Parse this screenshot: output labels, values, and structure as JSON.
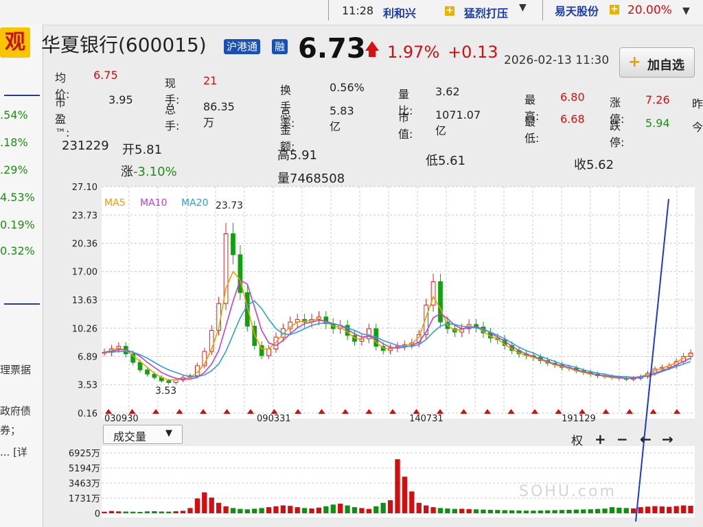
{
  "topbar": {
    "time": "11:28",
    "stock1": "利和兴",
    "message": "猛烈打压",
    "stock2": "易天股份",
    "stock2_pct": "20.00%"
  },
  "left_panel": {
    "logo_char": "观",
    "pcts": [
      ".54%",
      ".18%",
      ".29%",
      "4.53%",
      "0.19%",
      "0.32%"
    ],
    "texts": [
      "理票据",
      "政府债",
      "券；",
      "... [详"
    ]
  },
  "header": {
    "name": "华夏银行(600015)",
    "badge1": "沪港通",
    "badge2": "融",
    "price": "6.73",
    "pct": "1.97%",
    "change": "+0.13",
    "datetime": "2026-02-13 11:30",
    "add_button": "加自选"
  },
  "stats": {
    "avg_label": "均价:",
    "avg": "6.75",
    "pe_label": "市盈™:",
    "pe": "3.95",
    "cur_hand_label": "现手:",
    "cur_hand": "21",
    "total_hand_label": "总手:",
    "total_hand": "86.35万",
    "turnover_label": "换手率:",
    "turnover": "0.56%",
    "amount_label": "总金额:",
    "amount": "5.83亿",
    "vol_ratio_label": "量比:",
    "vol_ratio": "3.62",
    "mcap_label": "市值:",
    "mcap": "1071.07亿",
    "high_label": "最高:",
    "high": "6.80",
    "low_label": "最低:",
    "low": "6.68",
    "limit_up_label": "涨停:",
    "limit_up": "7.26",
    "limit_down_label": "跌停:",
    "limit_down": "5.94",
    "cut1": "昨",
    "cut2": "今"
  },
  "candle_info": {
    "date": "231229",
    "open": "开5.81",
    "high": "高5.91",
    "low": "低5.61",
    "close": "收5.62",
    "change": "涨-3.10%",
    "volume": "量7468508"
  },
  "chart_data": {
    "type": "line",
    "y_ticks": [
      "27.10",
      "23.73",
      "20.36",
      "17.00",
      "13.63",
      "10.26",
      "6.89",
      "3.53",
      "0.16"
    ],
    "ylim": [
      0.16,
      27.1
    ],
    "x_ticks": [
      "030930",
      "090331",
      "140731",
      "191129"
    ],
    "legend": [
      "MA5",
      "MA10",
      "MA20"
    ],
    "max_label": "23.73",
    "min_label": "3.53",
    "x": [
      0,
      3,
      6,
      9,
      12,
      15,
      18,
      21,
      24,
      27,
      30,
      33,
      36,
      39,
      42,
      45,
      48,
      51,
      54,
      57,
      60,
      63,
      66,
      69,
      72,
      75,
      78,
      81,
      84,
      87,
      90,
      93,
      96,
      99,
      102,
      105,
      108,
      111,
      114,
      117,
      120,
      123,
      126,
      129,
      132,
      135,
      138,
      141,
      144,
      147,
      150,
      153,
      156,
      159,
      162,
      165,
      168,
      171,
      174,
      177,
      180,
      183,
      186,
      189,
      192,
      195,
      198,
      201,
      204,
      207,
      210,
      213,
      216,
      219,
      222,
      225,
      228,
      231,
      234,
      237,
      240,
      243,
      246
    ],
    "close": [
      7.4,
      7.8,
      8.1,
      7.2,
      6.2,
      5.3,
      4.8,
      4.4,
      4.0,
      3.8,
      4.1,
      4.4,
      4.6,
      5.8,
      7.5,
      10.0,
      13.2,
      21.5,
      19.0,
      14.5,
      10.5,
      8.2,
      7.0,
      7.8,
      9.2,
      10.2,
      11.0,
      11.3,
      11.0,
      11.3,
      11.6,
      10.8,
      10.2,
      10.6,
      9.4,
      8.7,
      9.0,
      10.2,
      8.1,
      7.6,
      7.9,
      8.1,
      8.3,
      8.5,
      9.5,
      13.0,
      15.8,
      11.0,
      10.2,
      9.8,
      10.2,
      10.7,
      10.4,
      9.7,
      9.1,
      8.9,
      8.2,
      7.6,
      7.2,
      7.0,
      6.8,
      6.4,
      6.1,
      5.9,
      5.6,
      5.5,
      5.2,
      5.0,
      4.8,
      4.6,
      4.5,
      4.4,
      4.3,
      4.2,
      4.3,
      4.5,
      4.9,
      5.4,
      5.6,
      5.8,
      6.3,
      6.9,
      7.3
    ],
    "ma5": [
      7.4,
      7.6,
      7.9,
      7.6,
      7.0,
      6.3,
      5.6,
      4.9,
      4.4,
      4.1,
      4.1,
      4.2,
      4.4,
      5.0,
      6.0,
      7.8,
      10.2,
      15.0,
      17.0,
      16.0,
      12.8,
      9.5,
      7.8,
      7.8,
      8.6,
      9.6,
      10.4,
      11.0,
      11.1,
      11.2,
      11.4,
      11.0,
      10.5,
      10.4,
      9.8,
      9.1,
      8.9,
      9.5,
      8.6,
      7.9,
      7.8,
      8.0,
      8.2,
      8.4,
      9.2,
      11.6,
      14.0,
      12.6,
      10.6,
      10.0,
      10.1,
      10.5,
      10.4,
      9.9,
      9.3,
      9.0,
      8.3,
      7.8,
      7.3,
      7.0,
      6.8,
      6.5,
      6.2,
      5.9,
      5.7,
      5.5,
      5.2,
      5.0,
      4.8,
      4.7,
      4.5,
      4.4,
      4.3,
      4.3,
      4.3,
      4.5,
      4.8,
      5.2,
      5.5,
      5.8,
      6.2,
      6.7,
      7.1
    ],
    "ma10": [
      7.4,
      7.5,
      7.7,
      7.7,
      7.4,
      6.9,
      6.2,
      5.6,
      5.0,
      4.6,
      4.3,
      4.2,
      4.2,
      4.4,
      5.0,
      6.0,
      7.6,
      10.5,
      13.5,
      16.0,
      15.5,
      12.8,
      10.0,
      8.5,
      8.2,
      8.8,
      9.6,
      10.3,
      10.8,
      11.0,
      11.2,
      11.1,
      10.8,
      10.6,
      10.1,
      9.6,
      9.2,
      9.3,
      9.0,
      8.4,
      8.0,
      7.9,
      8.0,
      8.2,
      8.6,
      9.8,
      11.5,
      12.0,
      11.4,
      10.6,
      10.2,
      10.3,
      10.4,
      10.2,
      9.7,
      9.2,
      8.7,
      8.1,
      7.6,
      7.2,
      6.9,
      6.6,
      6.3,
      6.0,
      5.8,
      5.6,
      5.3,
      5.1,
      4.9,
      4.7,
      4.6,
      4.5,
      4.4,
      4.3,
      4.3,
      4.4,
      4.6,
      4.9,
      5.2,
      5.5,
      5.9,
      6.3,
      6.7
    ],
    "ma20": [
      7.4,
      7.4,
      7.5,
      7.5,
      7.4,
      7.1,
      6.7,
      6.2,
      5.7,
      5.3,
      5.0,
      4.7,
      4.5,
      4.5,
      4.7,
      5.2,
      6.0,
      7.5,
      9.5,
      11.5,
      13.0,
      13.5,
      12.6,
      11.3,
      10.2,
      9.6,
      9.5,
      9.8,
      10.2,
      10.6,
      10.8,
      10.9,
      10.8,
      10.6,
      10.3,
      10.0,
      9.6,
      9.4,
      9.2,
      8.8,
      8.5,
      8.2,
      8.1,
      8.1,
      8.3,
      8.9,
      9.8,
      10.5,
      10.8,
      10.7,
      10.5,
      10.4,
      10.3,
      10.1,
      9.8,
      9.4,
      9.0,
      8.5,
      8.0,
      7.6,
      7.3,
      6.9,
      6.6,
      6.3,
      6.0,
      5.8,
      5.6,
      5.3,
      5.1,
      4.9,
      4.8,
      4.6,
      4.5,
      4.5,
      4.4,
      4.5,
      4.6,
      4.8,
      5.1,
      5.4,
      5.7,
      6.0,
      6.3
    ]
  },
  "volume_chart": {
    "selector": "成交量",
    "y_ticks": [
      "6925万",
      "5194万",
      "3463万",
      "1731万",
      "0"
    ],
    "ymax": 6925,
    "controls": [
      "权",
      "+",
      "−",
      "←",
      "→"
    ],
    "values": [
      180,
      260,
      220,
      200,
      180,
      160,
      220,
      240,
      200,
      190,
      230,
      280,
      600,
      1700,
      2400,
      1800,
      1200,
      800,
      600,
      500,
      450,
      520,
      600,
      700,
      800,
      900,
      850,
      700,
      600,
      550,
      650,
      800,
      1000,
      1100,
      900,
      700,
      600,
      500,
      800,
      1200,
      1500,
      6200,
      4200,
      2500,
      1200,
      900,
      700,
      600,
      550,
      500,
      520,
      480,
      450,
      420,
      400,
      380,
      360,
      340,
      320,
      300,
      300,
      320,
      340,
      360,
      380,
      400,
      420,
      440,
      460,
      500,
      540,
      700,
      640,
      600,
      560,
      700,
      760,
      820,
      780,
      740,
      820,
      900,
      860
    ],
    "watermark": "SOHU.com"
  }
}
